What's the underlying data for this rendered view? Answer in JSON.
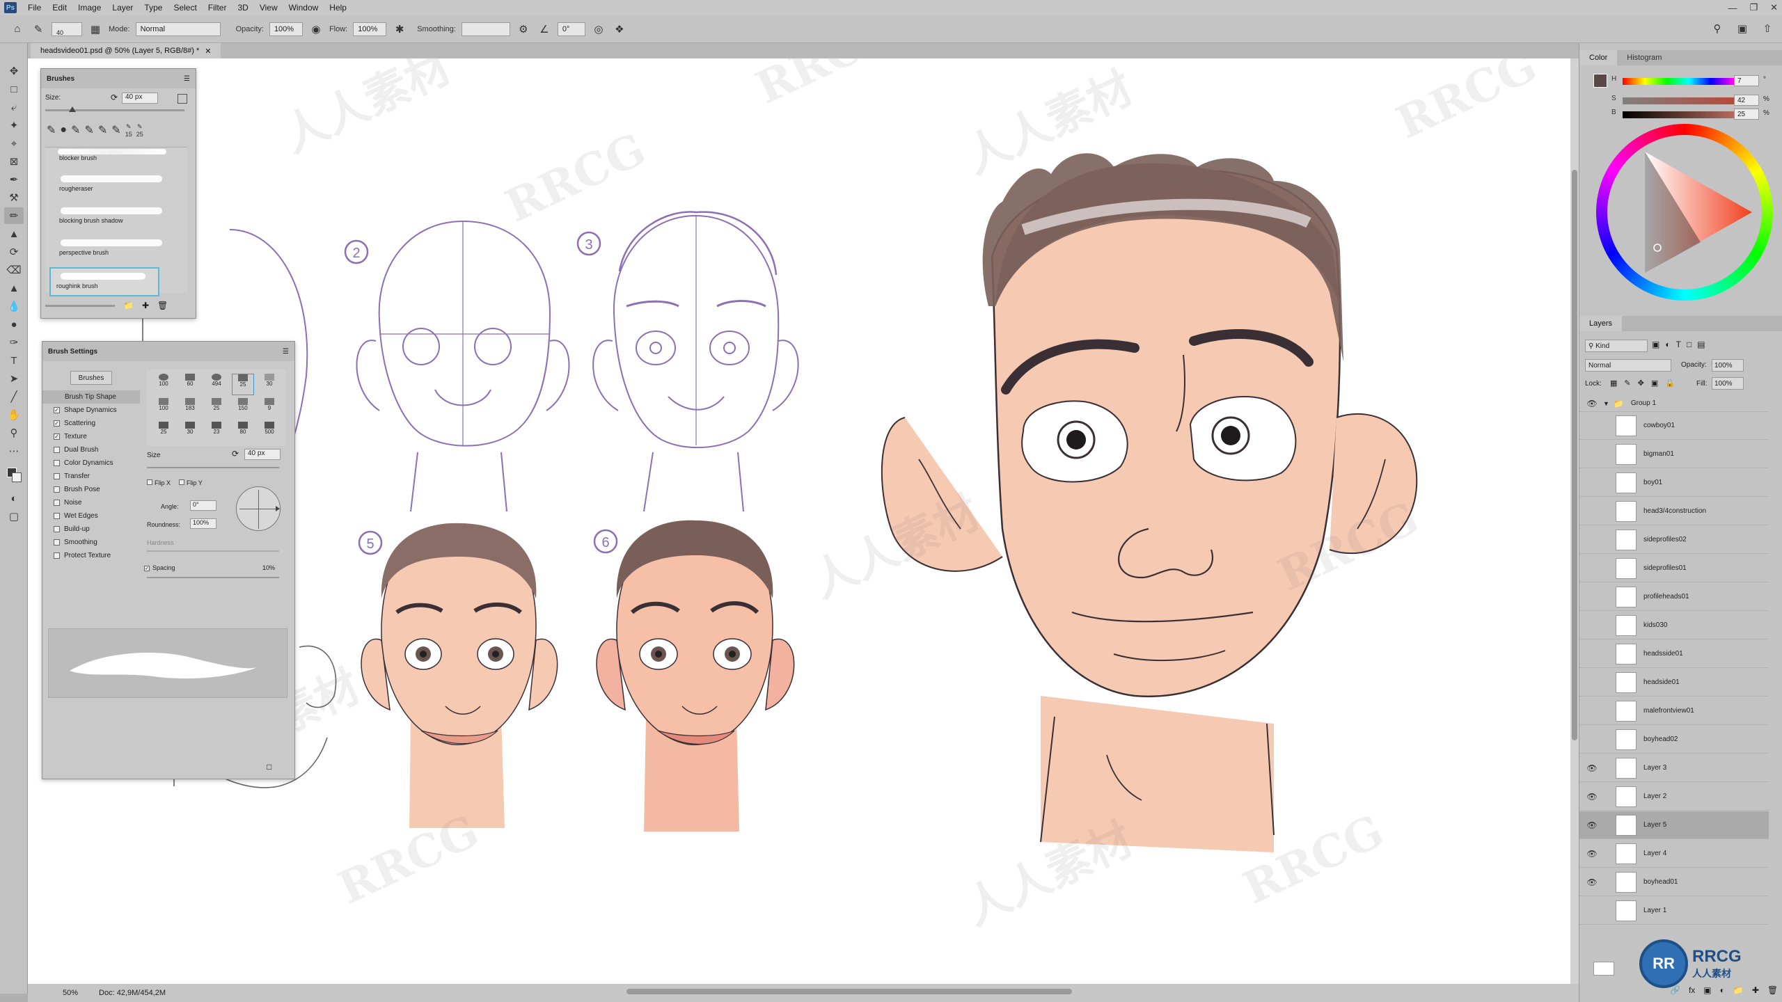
{
  "menu": {
    "logo": "Ps",
    "items": [
      "File",
      "Edit",
      "Image",
      "Layer",
      "Type",
      "Select",
      "Filter",
      "3D",
      "View",
      "Window",
      "Help"
    ]
  },
  "options": {
    "brush_size": "40",
    "mode_label": "Mode:",
    "mode_value": "Normal",
    "opacity_label": "Opacity:",
    "opacity_value": "100%",
    "flow_label": "Flow:",
    "flow_value": "100%",
    "smoothing_label": "Smoothing:",
    "angle_value": "0°"
  },
  "document": {
    "tab_title": "headsvideo01.psd @ 50% (Layer 5, RGB/8#) *",
    "zoom": "50%",
    "doc_info": "Doc: 42,9M/454,2M"
  },
  "step_numbers": [
    "2",
    "3",
    "5",
    "6"
  ],
  "brushes_panel": {
    "title": "Brushes",
    "size_label": "Size:",
    "size_value": "40 px",
    "presets": [
      "blocker brush",
      "rougheraser",
      "blocking brush shadow",
      "perspective brush",
      "roughink brush"
    ],
    "tip_sizes": [
      "15",
      "25"
    ]
  },
  "brush_settings_panel": {
    "title": "Brush Settings",
    "brushes_button": "Brushes",
    "options": [
      {
        "label": "Brush Tip Shape",
        "checked": null
      },
      {
        "label": "Shape Dynamics",
        "checked": true
      },
      {
        "label": "Scattering",
        "checked": true
      },
      {
        "label": "Texture",
        "checked": true
      },
      {
        "label": "Dual Brush",
        "checked": false
      },
      {
        "label": "Color Dynamics",
        "checked": false
      },
      {
        "label": "Transfer",
        "checked": false
      },
      {
        "label": "Brush Pose",
        "checked": false
      },
      {
        "label": "Noise",
        "checked": false
      },
      {
        "label": "Wet Edges",
        "checked": false
      },
      {
        "label": "Build-up",
        "checked": false
      },
      {
        "label": "Smoothing",
        "checked": false
      },
      {
        "label": "Protect Texture",
        "checked": false
      }
    ],
    "tip_sizes": [
      "100",
      "60",
      "494",
      "25",
      "30",
      "100",
      "183",
      "25",
      "150",
      "9",
      "25",
      "30",
      "23",
      "80",
      "500"
    ],
    "size_label": "Size",
    "size_value": "40 px",
    "flip_x": "Flip X",
    "flip_y": "Flip Y",
    "angle_label": "Angle:",
    "angle_value": "0°",
    "roundness_label": "Roundness:",
    "roundness_value": "100%",
    "hardness_label": "Hardness",
    "spacing_label": "Spacing",
    "spacing_value": "10%"
  },
  "color_panel": {
    "tabs": [
      "Color",
      "Histogram"
    ],
    "h_label": "H",
    "s_label": "S",
    "b_label": "B",
    "h_value": "7",
    "s_value": "42",
    "b_value": "25",
    "h_unit": "°",
    "pct": "%"
  },
  "layers_panel": {
    "tab": "Layers",
    "kind_label": "Kind",
    "blend_mode": "Normal",
    "opacity_label": "Opacity:",
    "opacity_value": "100%",
    "lock_label": "Lock:",
    "fill_label": "Fill:",
    "fill_value": "100%",
    "group_name": "Group 1",
    "layers": [
      {
        "name": "cowboy01",
        "visible": false,
        "selected": false
      },
      {
        "name": "bigman01",
        "visible": false,
        "selected": false
      },
      {
        "name": "boy01",
        "visible": false,
        "selected": false
      },
      {
        "name": "head3/4construction",
        "visible": false,
        "selected": false
      },
      {
        "name": "sideprofiles02",
        "visible": false,
        "selected": false
      },
      {
        "name": "sideprofiles01",
        "visible": false,
        "selected": false
      },
      {
        "name": "profileheads01",
        "visible": false,
        "selected": false
      },
      {
        "name": "kids030",
        "visible": false,
        "selected": false
      },
      {
        "name": "headsside01",
        "visible": false,
        "selected": false
      },
      {
        "name": "headside01",
        "visible": false,
        "selected": false
      },
      {
        "name": "malefrontview01",
        "visible": false,
        "selected": false
      },
      {
        "name": "boyhead02",
        "visible": false,
        "selected": false
      },
      {
        "name": "Layer 3",
        "visible": true,
        "selected": false
      },
      {
        "name": "Layer 2",
        "visible": true,
        "selected": false
      },
      {
        "name": "Layer 5",
        "visible": true,
        "selected": true
      },
      {
        "name": "Layer 4",
        "visible": true,
        "selected": false
      },
      {
        "name": "boyhead01",
        "visible": true,
        "selected": false
      },
      {
        "name": "Layer 1",
        "visible": false,
        "selected": false
      }
    ]
  },
  "watermark": {
    "brand": "RRCG",
    "cn": "人人素材"
  },
  "colors": {
    "skin": "#f6c9b2",
    "hair": "#8a6d66",
    "sketch_purple": "#8c6fb5",
    "line": "#3a2f35",
    "ui_bg": "#c3c3c3"
  }
}
